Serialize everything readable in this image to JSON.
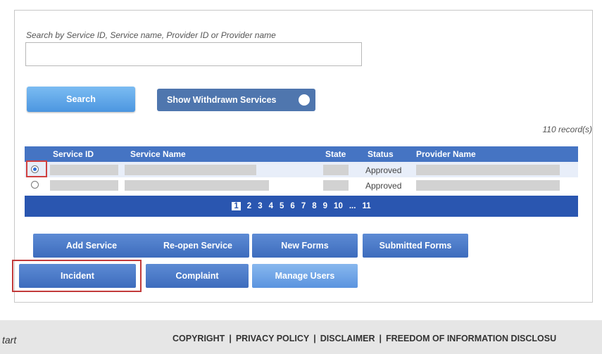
{
  "search": {
    "label": "Search by Service ID, Service name, Provider ID or Provider name",
    "value": ""
  },
  "buttons": {
    "search": "Search",
    "show_withdrawn": "Show Withdrawn Services"
  },
  "records": "110 record(s)",
  "table": {
    "columns": [
      "Service ID",
      "Service Name",
      "State",
      "Status",
      "Provider Name"
    ],
    "rows": [
      {
        "selected": true,
        "status": "Approved"
      },
      {
        "selected": false,
        "status": "Approved"
      }
    ]
  },
  "pager": {
    "pages": [
      "1",
      "2",
      "3",
      "4",
      "5",
      "6",
      "7",
      "8",
      "9",
      "10"
    ],
    "ellipsis": "...",
    "last": "11",
    "current": "1"
  },
  "actions": {
    "add_service": "Add Service",
    "reopen_service": "Re-open Service",
    "new_forms": "New Forms",
    "submitted_forms": "Submitted Forms",
    "incident": "Incident",
    "complaint": "Complaint",
    "manage_users": "Manage Users"
  },
  "footer": {
    "start": "tart",
    "links": [
      "COPYRIGHT",
      "PRIVACY POLICY",
      "DISCLAIMER",
      "FREEDOM OF INFORMATION DISCLOSU"
    ]
  }
}
